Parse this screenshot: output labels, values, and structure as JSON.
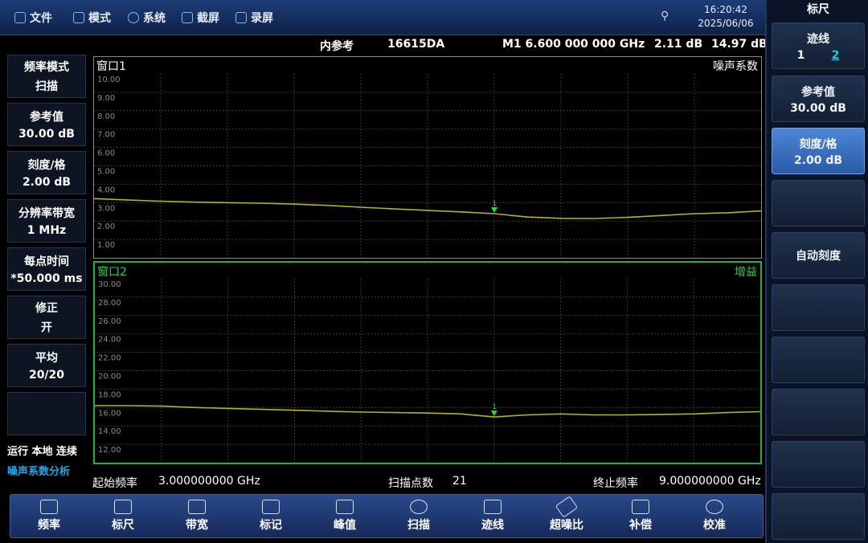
{
  "topbar": {
    "menu": [
      {
        "label": "文件",
        "icon": "file-icon"
      },
      {
        "label": "模式",
        "icon": "mode-icon"
      },
      {
        "label": "系统",
        "icon": "system-gear-icon"
      },
      {
        "label": "截屏",
        "icon": "camera-icon"
      },
      {
        "label": "录屏",
        "icon": "record-icon"
      }
    ],
    "time": "16:20:42",
    "date": "2025/06/06"
  },
  "info": {
    "ref": "内参考",
    "model": "16615DA",
    "marker": "M1  6.600 000 000 GHz",
    "val1": "2.11 dB",
    "val2": "14.97 dB"
  },
  "left_panel": [
    {
      "label": "频率模式",
      "value": "扫描"
    },
    {
      "label": "参考值",
      "value": "30.00 dB"
    },
    {
      "label": "刻度/格",
      "value": "2.00 dB"
    },
    {
      "label": "分辨率带宽",
      "value": "1 MHz"
    },
    {
      "label": "每点时间",
      "value": "*50.000 ms"
    },
    {
      "label": "修正",
      "value": "开"
    },
    {
      "label": "平均",
      "value": "20/20"
    },
    {
      "label": "",
      "value": ""
    }
  ],
  "status": {
    "run": "运行 本地 连续",
    "mode": "噪声系数分析"
  },
  "window1": {
    "title": "窗口1",
    "measure": "噪声系数",
    "ticks": [
      "10.00",
      "9.00",
      "8.00",
      "7.00",
      "6.00",
      "5.00",
      "4.00",
      "3.00",
      "2.00",
      "1.00"
    ],
    "marker_label": "1",
    "color": "#b7b21e"
  },
  "window2": {
    "title": "窗口2",
    "measure": "增益",
    "ticks": [
      "30.00",
      "28.00",
      "26.00",
      "24.00",
      "22.00",
      "20.00",
      "18.00",
      "16.00",
      "14.00",
      "12.00"
    ],
    "marker_label": "1",
    "color": "#b7b21e"
  },
  "chart_data": [
    {
      "type": "line",
      "title": "噪声系数",
      "x": [
        3.0,
        3.3,
        3.6,
        3.9,
        4.2,
        4.5,
        4.8,
        5.1,
        5.4,
        5.7,
        6.0,
        6.3,
        6.6,
        6.9,
        7.2,
        7.5,
        7.8,
        8.1,
        8.4,
        8.7,
        9.0
      ],
      "values": [
        3.22,
        3.15,
        3.08,
        3.03,
        3.0,
        2.97,
        2.92,
        2.85,
        2.75,
        2.66,
        2.58,
        2.5,
        2.4,
        2.22,
        2.15,
        2.14,
        2.2,
        2.3,
        2.4,
        2.45,
        2.55
      ],
      "ylim": [
        0,
        10
      ],
      "marker_x": 6.6
    },
    {
      "type": "line",
      "title": "增益",
      "x": [
        3.0,
        3.3,
        3.6,
        3.9,
        4.2,
        4.5,
        4.8,
        5.1,
        5.4,
        5.7,
        6.0,
        6.3,
        6.6,
        6.9,
        7.2,
        7.5,
        7.8,
        8.1,
        8.4,
        8.7,
        9.0
      ],
      "values": [
        16.2,
        16.2,
        16.15,
        16.0,
        15.9,
        15.8,
        15.7,
        15.6,
        15.5,
        15.45,
        15.4,
        15.3,
        14.97,
        15.2,
        15.3,
        15.2,
        15.2,
        15.25,
        15.3,
        15.45,
        15.55
      ],
      "ylim": [
        10,
        30
      ],
      "marker_x": 6.6
    }
  ],
  "freq": {
    "start_label": "起始频率",
    "start": "3.000000000 GHz",
    "points_label": "扫描点数",
    "points": "21",
    "stop_label": "终止频率",
    "stop": "9.000000000 GHz"
  },
  "softkeys": {
    "title": "标尺",
    "trace_label": "迹线",
    "trace_1": "1",
    "trace_2": "2",
    "ref_label": "参考值",
    "ref_value": "30.00 dB",
    "scale_label": "刻度/格",
    "scale_value": "2.00 dB",
    "auto_scale": "自动刻度"
  },
  "toolbar": [
    "频率",
    "标尺",
    "带宽",
    "标记",
    "峰值",
    "扫描",
    "迹线",
    "超噪比",
    "补偿",
    "校准"
  ]
}
